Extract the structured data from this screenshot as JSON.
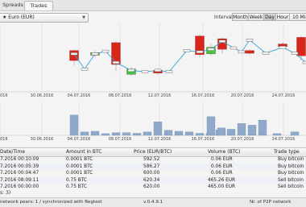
{
  "tabs": [
    {
      "label": "Spreads",
      "active": false
    },
    {
      "label": "Trades",
      "active": true
    }
  ],
  "controls": {
    "currency": "★ Euro (EUR)",
    "interval_label": "Interval:",
    "intervals": [
      {
        "label": "Month",
        "selected": false
      },
      {
        "label": "Week",
        "selected": false
      },
      {
        "label": "Day",
        "selected": true
      },
      {
        "label": "Hour",
        "selected": false
      },
      {
        "label": "10 Minutes",
        "selected": false
      }
    ]
  },
  "chart_data": {
    "type": "candlestick",
    "x_ticks": [
      "",
      "30.06.2016",
      "04.07.2016",
      "08.07.2016",
      "12.07.2016",
      "16.07.2016",
      "20.07.2016",
      "24.07.2016"
    ],
    "candles": [
      {
        "open": 0.45,
        "close": 0.6,
        "high": 0.62,
        "low": 0.38,
        "color": "red"
      },
      {
        "open": 0.57,
        "close": 0.53,
        "high": 0.6,
        "low": 0.5,
        "color": "green"
      },
      {
        "open": 0.72,
        "close": 0.39,
        "high": 0.75,
        "low": 0.28,
        "color": "red"
      },
      {
        "open": 0.32,
        "close": 0.24,
        "high": 0.35,
        "low": 0.22,
        "color": "green"
      },
      {
        "open": 0.3,
        "close": 0.26,
        "high": 0.33,
        "low": 0.23,
        "color": "red"
      },
      {
        "open": 0.82,
        "close": 0.54,
        "high": 0.85,
        "low": 0.5,
        "color": "red"
      },
      {
        "open": 0.55,
        "close": 0.65,
        "high": 0.7,
        "low": 0.52,
        "color": "green"
      },
      {
        "open": 0.78,
        "close": 0.62,
        "high": 0.8,
        "low": 0.55,
        "color": "red"
      },
      {
        "open": 0.6,
        "close": 0.56,
        "high": 0.62,
        "low": 0.54,
        "color": "red"
      },
      {
        "open": 0.7,
        "close": 0.66,
        "high": 0.72,
        "low": 0.63,
        "color": "red"
      },
      {
        "open": 0.8,
        "close": 0.52,
        "high": 0.82,
        "low": 0.45,
        "color": "red"
      }
    ],
    "line": [
      0.55,
      0.32,
      0.55,
      0.59,
      0.42,
      0.3,
      0.28,
      0.3,
      0.28,
      0.6,
      0.58,
      0.62,
      0.74,
      0.64,
      0.58,
      0.76,
      0.56,
      0.65,
      0.56,
      0.42
    ],
    "volume": [
      0.6,
      0.1,
      0.12,
      0.05,
      0.08,
      0.08,
      0.06,
      0.1,
      0.4,
      0.15,
      0.12,
      0.1,
      0.06,
      0.06,
      0.16,
      0.55,
      0.22,
      0.18,
      0.35,
      0.3,
      0.45,
      0.05,
      0.1
    ]
  },
  "table": {
    "columns": [
      "Date/Time",
      "Amount in BTC",
      "Price (EUR/BTC)",
      "Volume (BTC)",
      "Trade type"
    ],
    "rows": [
      [
        "7.2016 00:10:09",
        "0.0001 BTC",
        "592.52",
        "0.06 EUR",
        "Buy bitcoin"
      ],
      [
        "7.2016 00:05:39",
        "0.0001 BTC",
        "586.27",
        "0.06 EUR",
        "Buy bitcoin"
      ],
      [
        "7.2016 00:04:47",
        "0.0001 BTC",
        "600.00",
        "0.06 EUR",
        "Buy bitcoin"
      ],
      [
        "7.2016 08:09:11",
        "0.75 BTC",
        "620.34",
        "465.26 EUR",
        "Sell bitcoin"
      ],
      [
        "7.2016 00:00:00",
        "0.75 BTC",
        "620.00",
        "465.00 EUR",
        "Sell bitcoin"
      ],
      [
        "7.2016 00:00:00",
        "0.75 BTC",
        "620.00",
        "465.00 EUR",
        "Sell bitcoin"
      ]
    ],
    "count_text": "s: 3)"
  },
  "status": {
    "left": "network peers: 1 / synchronized with Regtest",
    "version": "v.0.4.9.1",
    "right": "Nr. of P2P network"
  }
}
